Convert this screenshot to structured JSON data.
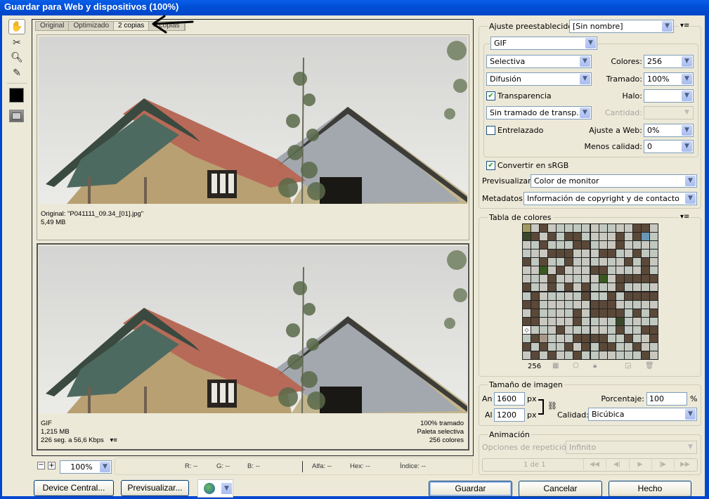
{
  "window": {
    "title": "Guardar para Web y dispositivos (100%)"
  },
  "toolbar": {
    "tools": [
      "hand-tool",
      "slice-select-tool",
      "zoom-tool",
      "eyedropper-tool"
    ],
    "eyedropper_color": "#000000"
  },
  "tabs": [
    {
      "label": "Original",
      "selected": false
    },
    {
      "label": "Optimizado",
      "selected": false
    },
    {
      "label": "2 copias",
      "selected": true
    },
    {
      "label": "4 copias",
      "selected": false
    }
  ],
  "preview_top": {
    "line1": "Original: \"P041111_09.34_[01].jpg\"",
    "line2": "5,49 MB"
  },
  "preview_bottom": {
    "format": "GIF",
    "size": "1,215 MB",
    "speed": "226 seg. a 56,6 Kbps",
    "dither": "100% tramado",
    "palette": "Paleta selectiva",
    "colors": "256 colores"
  },
  "status": {
    "zoom": "100%",
    "r": "R: --",
    "g": "G: --",
    "b": "B: --",
    "alpha": "Alfa: --",
    "hex": "Hex: --",
    "index": "Índice: --"
  },
  "buttons": {
    "device_central": "Device Central...",
    "preview": "Previsualizar...",
    "save": "Guardar",
    "cancel": "Cancelar",
    "done": "Hecho"
  },
  "settings": {
    "preset_label": "Ajuste preestablecido:",
    "preset_value": "[Sin nombre]",
    "format": "GIF",
    "reduction": "Selectiva",
    "dither_algo": "Difusión",
    "colors_label": "Colores:",
    "colors_value": "256",
    "dither_label": "Tramado:",
    "dither_value": "100%",
    "transparency_label": "Transparencia",
    "transparency_checked": true,
    "matte_label": "Halo:",
    "matte_value": "",
    "transp_dither": "Sin tramado de transp...",
    "amount_label": "Cantidad:",
    "amount_value": "",
    "interlaced_label": "Entrelazado",
    "interlaced_checked": false,
    "web_snap_label": "Ajuste a Web:",
    "web_snap_value": "0%",
    "lossy_label": "Menos calidad:",
    "lossy_value": "0",
    "srgb_label": "Convertir en sRGB",
    "srgb_checked": true,
    "preview_label": "Previsualizar:",
    "preview_value": "Color de monitor",
    "metadata_label": "Metadatos:",
    "metadata_value": "Información de copyright y de contacto"
  },
  "color_table": {
    "title": "Tabla de colores",
    "count": "256",
    "palette": [
      "#c8c8c0",
      "#a8a890",
      "#5a6050",
      "#1a1a14",
      "#b8b8b8",
      "#3a4a30",
      "#9a8878",
      "#7a7a90",
      "#8a8470",
      "#a89888",
      "#7a8890",
      "#5a5a58",
      "#b8b0a8",
      "#707870",
      "#a08878",
      "#3a4848",
      "#5a4838",
      "#6a7078",
      "#4a5040",
      "#88907a",
      "#a0a088",
      "#6a7a50",
      "#485838",
      "#d8d0c0",
      "#384828",
      "#788860",
      "#c0b8c8",
      "#e8e8e8",
      "#7a6a50",
      "#b8c8d8",
      "#e8d8e0",
      "#303020",
      "#c0c8c0",
      "#98b0a0",
      "#306878",
      "#b8a040",
      "#a09a60",
      "#c07858",
      "#285870",
      "#307040",
      "#6898b8",
      "#385820",
      "#60a8c0",
      "#f8f8f8",
      "#8a9aa0",
      "#d0d0e0",
      "#a06838",
      "#208080"
    ]
  },
  "image_size": {
    "title": "Tamaño de imagen",
    "width_label": "An",
    "width": "1600",
    "unit": "px",
    "height_label": "Al",
    "height": "1200",
    "percent_label": "Porcentaje:",
    "percent": "100",
    "percent_unit": "%",
    "quality_label": "Calidad:",
    "quality": "Bicúbica"
  },
  "animation": {
    "title": "Animación",
    "loop_label": "Opciones de repetición:",
    "loop_value": "Infinito",
    "frame": "1 de 1"
  }
}
